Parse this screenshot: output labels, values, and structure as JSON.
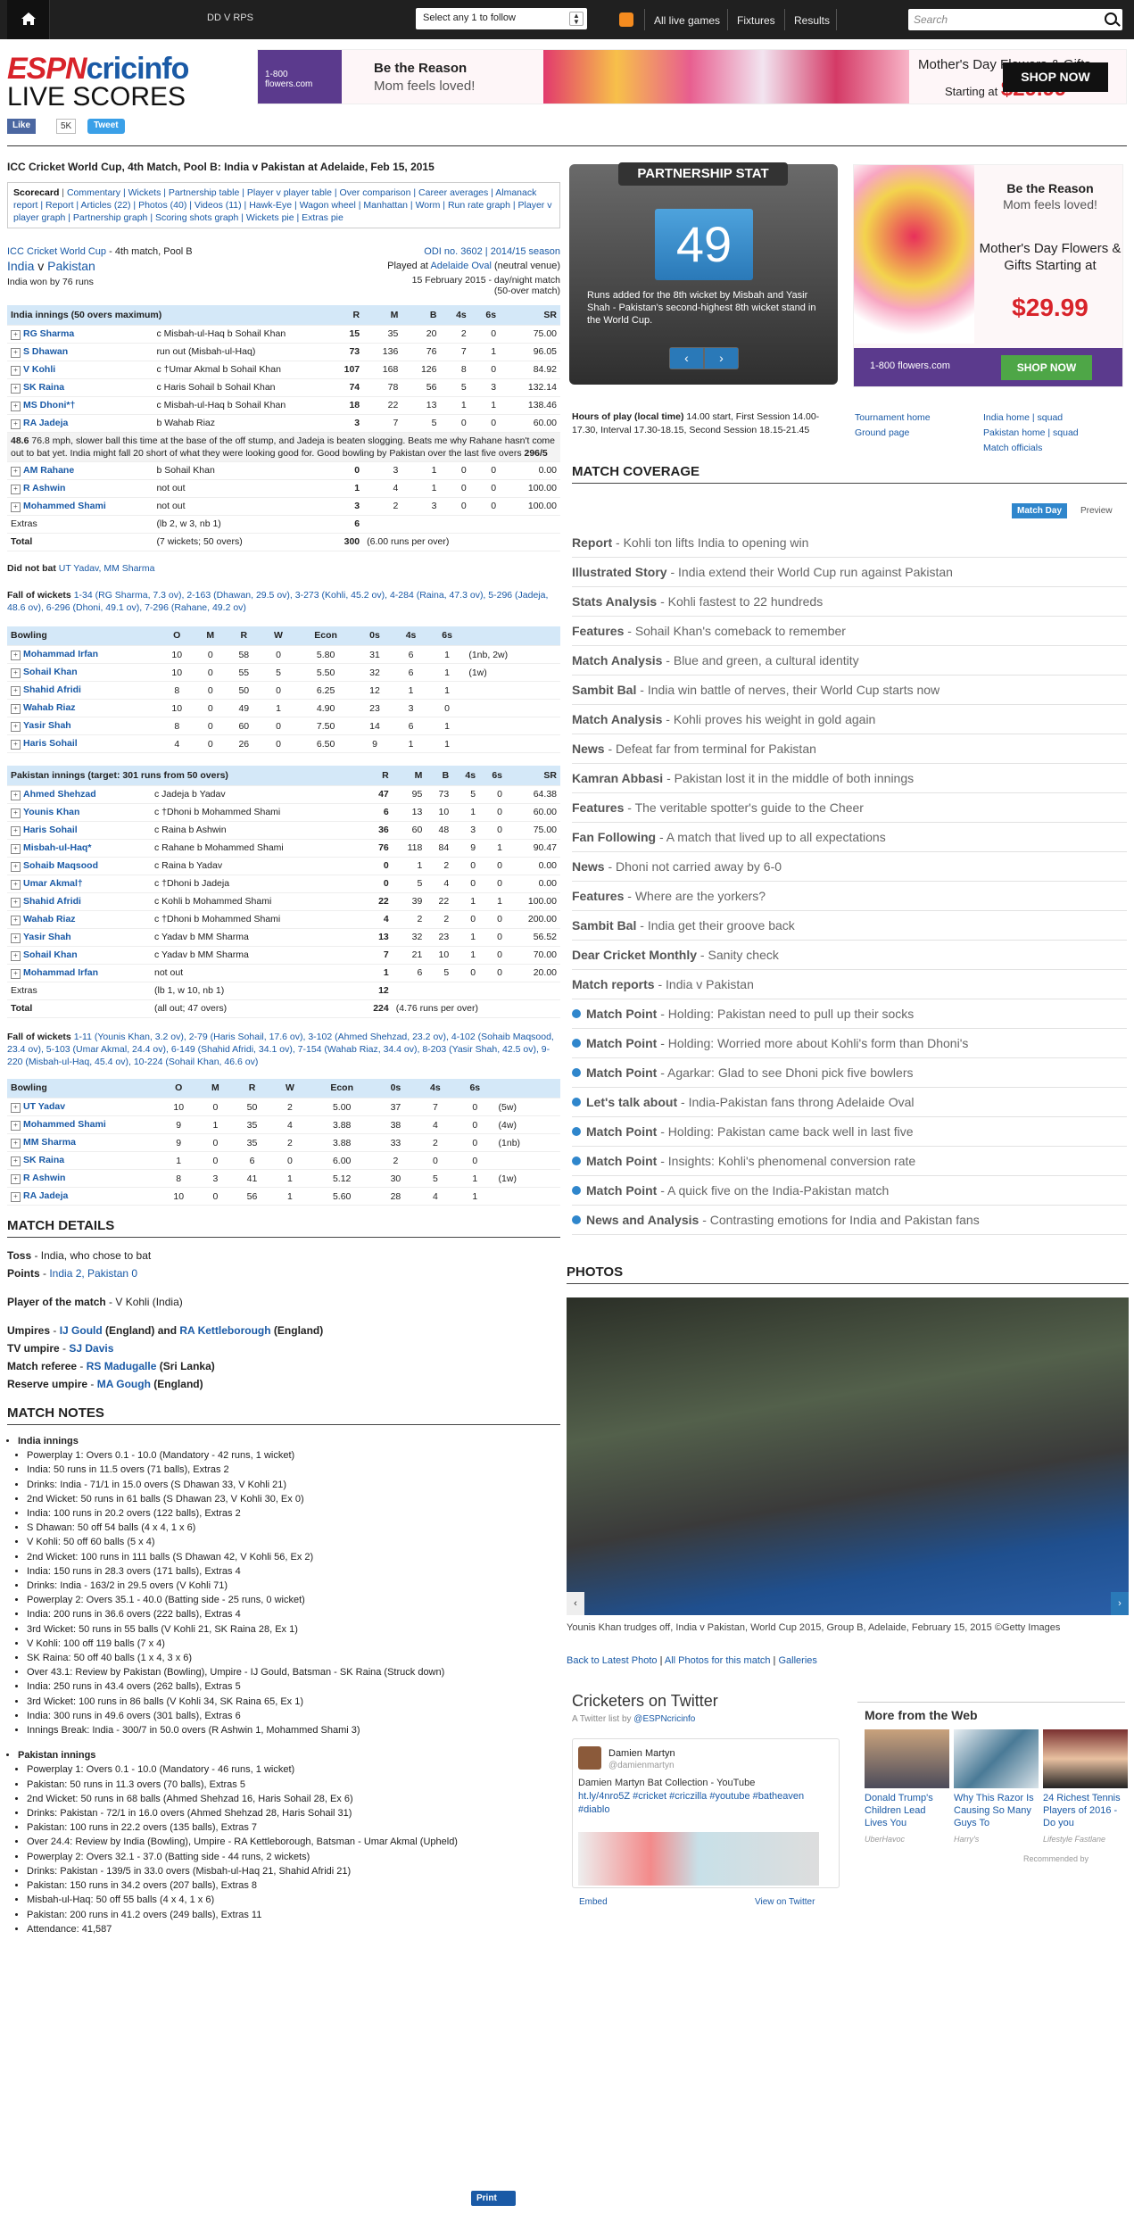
{
  "topbar": {
    "ddvrps": "DD V RPS",
    "follow": "Select any 1 to follow",
    "nav": [
      "All live games",
      "Fixtures",
      "Results"
    ],
    "search_placeholder": "Search"
  },
  "header": {
    "logo_espn": "ESPN",
    "logo_cric": "cricinfo",
    "live": "LIVE SCORES",
    "fb_like": "Like",
    "fb_count": "5K",
    "tweet": "Tweet"
  },
  "topad": {
    "brand": "1-800 flowers.com",
    "t1": "Be the Reason",
    "t2": "Mom feels loved!",
    "t3": "Mother's Day Flowers & Gifts",
    "t4_prefix": "Starting at ",
    "price": "$29.99",
    "shop": "SHOP NOW"
  },
  "match": {
    "title": "ICC Cricket World Cup, 4th Match, Pool B: India v Pakistan at Adelaide, Feb 15, 2015",
    "links_label": "Scorecard",
    "links": "Commentary | Wickets | Partnership table | Player v player table | Over comparison | Career averages | Almanack report | Report | Articles (22) | Photos (40) | Videos (11) | Hawk-Eye | Wagon wheel | Manhattan | Worm | Run rate graph | Player v player graph | Partnership graph | Scoring shots graph | Wickets pie | Extras pie",
    "series": "ICC Cricket World Cup",
    "matchno": " - 4th match, Pool B",
    "odi": "ODI no. 3602 | 2014/15 season",
    "t1": "India",
    "v": " v ",
    "t2": "Pakistan",
    "played_at": "Played at ",
    "venue": "Adelaide Oval",
    "neutral": " (neutral venue)",
    "result": "India won by 76 runs",
    "date": "15 February 2015 - day/night match",
    "overs": "(50-over match)"
  },
  "india_bat": {
    "hd": [
      "India innings (50 overs maximum)",
      "R",
      "M",
      "B",
      "4s",
      "6s",
      "SR"
    ],
    "rows": [
      [
        "RG Sharma",
        "c Misbah-ul-Haq b Sohail Khan",
        "15",
        "35",
        "20",
        "2",
        "0",
        "75.00"
      ],
      [
        "S Dhawan",
        "run out (Misbah-ul-Haq)",
        "73",
        "136",
        "76",
        "7",
        "1",
        "96.05"
      ],
      [
        "V Kohli",
        "c †Umar Akmal b Sohail Khan",
        "107",
        "168",
        "126",
        "8",
        "0",
        "84.92"
      ],
      [
        "SK Raina",
        "c Haris Sohail b Sohail Khan",
        "74",
        "78",
        "56",
        "5",
        "3",
        "132.14"
      ],
      [
        "MS Dhoni*†",
        "c Misbah-ul-Haq b Sohail Khan",
        "18",
        "22",
        "13",
        "1",
        "1",
        "138.46"
      ],
      [
        "RA Jadeja",
        "b Wahab Riaz",
        "3",
        "7",
        "5",
        "0",
        "0",
        "60.00"
      ]
    ],
    "comm_ov": "48.6",
    "comm": "76.8 mph, slower ball this time at the base of the off stump, and Jadeja is beaten slogging. Beats me why Rahane hasn't come out to bat yet. India might fall 20 short of what they were looking good for. Good bowling by Pakistan over the last five overs ",
    "comm_score": "296/5",
    "rows2": [
      [
        "AM Rahane",
        "b Sohail Khan",
        "0",
        "3",
        "1",
        "0",
        "0",
        "0.00"
      ],
      [
        "R Ashwin",
        "not out",
        "1",
        "4",
        "1",
        "0",
        "0",
        "100.00"
      ],
      [
        "Mohammed Shami",
        "not out",
        "3",
        "2",
        "3",
        "0",
        "0",
        "100.00"
      ]
    ],
    "extras": [
      "Extras",
      "(lb 2, w 3, nb 1)",
      "6"
    ],
    "total": [
      "Total",
      "(7 wickets; 50 overs)",
      "300",
      "(6.00 runs per over)"
    ],
    "dnb_label": "Did not bat ",
    "dnb": "UT Yadav, MM Sharma",
    "fow_label": "Fall of wickets ",
    "fow": "1-34 (RG Sharma, 7.3 ov), 2-163 (Dhawan, 29.5 ov), 3-273 (Kohli, 45.2 ov), 4-284 (Raina, 47.3 ov), 5-296 (Jadeja, 48.6 ov), 6-296 (Dhoni, 49.1 ov), 7-296 (Rahane, 49.2 ov)"
  },
  "pak_bowl": {
    "hd": [
      "Bowling",
      "O",
      "M",
      "R",
      "W",
      "Econ",
      "0s",
      "4s",
      "6s",
      ""
    ],
    "rows": [
      [
        "Mohammad Irfan",
        "10",
        "0",
        "58",
        "0",
        "5.80",
        "31",
        "6",
        "1",
        "(1nb, 2w)"
      ],
      [
        "Sohail Khan",
        "10",
        "0",
        "55",
        "5",
        "5.50",
        "32",
        "6",
        "1",
        "(1w)"
      ],
      [
        "Shahid Afridi",
        "8",
        "0",
        "50",
        "0",
        "6.25",
        "12",
        "1",
        "1",
        ""
      ],
      [
        "Wahab Riaz",
        "10",
        "0",
        "49",
        "1",
        "4.90",
        "23",
        "3",
        "0",
        ""
      ],
      [
        "Yasir Shah",
        "8",
        "0",
        "60",
        "0",
        "7.50",
        "14",
        "6",
        "1",
        ""
      ],
      [
        "Haris Sohail",
        "4",
        "0",
        "26",
        "0",
        "6.50",
        "9",
        "1",
        "1",
        ""
      ]
    ]
  },
  "pak_bat": {
    "hd": [
      "Pakistan innings (target: 301 runs from 50 overs)",
      "R",
      "M",
      "B",
      "4s",
      "6s",
      "SR"
    ],
    "rows": [
      [
        "Ahmed Shehzad",
        "c Jadeja b Yadav",
        "47",
        "95",
        "73",
        "5",
        "0",
        "64.38"
      ],
      [
        "Younis Khan",
        "c †Dhoni b Mohammed Shami",
        "6",
        "13",
        "10",
        "1",
        "0",
        "60.00"
      ],
      [
        "Haris Sohail",
        "c Raina b Ashwin",
        "36",
        "60",
        "48",
        "3",
        "0",
        "75.00"
      ],
      [
        "Misbah-ul-Haq*",
        "c Rahane b Mohammed Shami",
        "76",
        "118",
        "84",
        "9",
        "1",
        "90.47"
      ],
      [
        "Sohaib Maqsood",
        "c Raina b Yadav",
        "0",
        "1",
        "2",
        "0",
        "0",
        "0.00"
      ],
      [
        "Umar Akmal†",
        "c †Dhoni b Jadeja",
        "0",
        "5",
        "4",
        "0",
        "0",
        "0.00"
      ],
      [
        "Shahid Afridi",
        "c Kohli b Mohammed Shami",
        "22",
        "39",
        "22",
        "1",
        "1",
        "100.00"
      ],
      [
        "Wahab Riaz",
        "c †Dhoni b Mohammed Shami",
        "4",
        "2",
        "2",
        "0",
        "0",
        "200.00"
      ],
      [
        "Yasir Shah",
        "c Yadav b MM Sharma",
        "13",
        "32",
        "23",
        "1",
        "0",
        "56.52"
      ],
      [
        "Sohail Khan",
        "c Yadav b MM Sharma",
        "7",
        "21",
        "10",
        "1",
        "0",
        "70.00"
      ],
      [
        "Mohammad Irfan",
        "not out",
        "1",
        "6",
        "5",
        "0",
        "0",
        "20.00"
      ]
    ],
    "extras": [
      "Extras",
      "(lb 1, w 10, nb 1)",
      "12"
    ],
    "total": [
      "Total",
      "(all out; 47 overs)",
      "224",
      "(4.76 runs per over)"
    ],
    "fow_label": "Fall of wickets ",
    "fow": "1-11 (Younis Khan, 3.2 ov), 2-79 (Haris Sohail, 17.6 ov), 3-102 (Ahmed Shehzad, 23.2 ov), 4-102 (Sohaib Maqsood, 23.4 ov), 5-103 (Umar Akmal, 24.4 ov), 6-149 (Shahid Afridi, 34.1 ov), 7-154 (Wahab Riaz, 34.4 ov), 8-203 (Yasir Shah, 42.5 ov), 9-220 (Misbah-ul-Haq, 45.4 ov), 10-224 (Sohail Khan, 46.6 ov)"
  },
  "ind_bowl": {
    "hd": [
      "Bowling",
      "O",
      "M",
      "R",
      "W",
      "Econ",
      "0s",
      "4s",
      "6s",
      ""
    ],
    "rows": [
      [
        "UT Yadav",
        "10",
        "0",
        "50",
        "2",
        "5.00",
        "37",
        "7",
        "0",
        "(5w)"
      ],
      [
        "Mohammed Shami",
        "9",
        "1",
        "35",
        "4",
        "3.88",
        "38",
        "4",
        "0",
        "(4w)"
      ],
      [
        "MM Sharma",
        "9",
        "0",
        "35",
        "2",
        "3.88",
        "33",
        "2",
        "0",
        "(1nb)"
      ],
      [
        "SK Raina",
        "1",
        "0",
        "6",
        "0",
        "6.00",
        "2",
        "0",
        "0",
        ""
      ],
      [
        "R Ashwin",
        "8",
        "3",
        "41",
        "1",
        "5.12",
        "30",
        "5",
        "1",
        "(1w)"
      ],
      [
        "RA Jadeja",
        "10",
        "0",
        "56",
        "1",
        "5.60",
        "28",
        "4",
        "1",
        ""
      ]
    ]
  },
  "details": {
    "h": "MATCH DETAILS",
    "toss_l": "Toss",
    "toss": " - India, who chose to bat",
    "pts_l": "Points",
    "pts": "India 2, Pakistan 0",
    "pom_l": "Player of the match",
    "pom": " - V Kohli (India)",
    "ump_l": "Umpires",
    "ump1": "IJ Gould",
    "ump1c": " (England) and ",
    "ump2": "RA Kettleborough",
    "ump2c": " (England)",
    "tv_l": "TV umpire",
    "tv": "SJ Davis",
    "ref_l": "Match referee",
    "ref": "RS Madugalle",
    "refc": " (Sri Lanka)",
    "res_l": "Reserve umpire",
    "res": "MA Gough",
    "resc": " (England)"
  },
  "notes": {
    "h": "MATCH NOTES",
    "ind_h": "India innings",
    "ind": [
      "Powerplay 1: Overs 0.1 - 10.0 (Mandatory - 42 runs, 1 wicket)",
      "India: 50 runs in 11.5 overs (71 balls), Extras 2",
      "Drinks: India - 71/1 in 15.0 overs (S Dhawan 33, V Kohli 21)",
      "2nd Wicket: 50 runs in 61 balls (S Dhawan 23, V Kohli 30, Ex 0)",
      "India: 100 runs in 20.2 overs (122 balls), Extras 2",
      "S Dhawan: 50 off 54 balls (4 x 4, 1 x 6)",
      "V Kohli: 50 off 60 balls (5 x 4)",
      "2nd Wicket: 100 runs in 111 balls (S Dhawan 42, V Kohli 56, Ex 2)",
      "India: 150 runs in 28.3 overs (171 balls), Extras 4",
      "Drinks: India - 163/2 in 29.5 overs (V Kohli 71)",
      "Powerplay 2: Overs 35.1 - 40.0 (Batting side - 25 runs, 0 wicket)",
      "India: 200 runs in 36.6 overs (222 balls), Extras 4",
      "3rd Wicket: 50 runs in 55 balls (V Kohli 21, SK Raina 28, Ex 1)",
      "V Kohli: 100 off 119 balls (7 x 4)",
      "SK Raina: 50 off 40 balls (1 x 4, 3 x 6)",
      "Over 43.1: Review by Pakistan (Bowling), Umpire - IJ Gould, Batsman - SK Raina (Struck down)",
      "India: 250 runs in 43.4 overs (262 balls), Extras 5",
      "3rd Wicket: 100 runs in 86 balls (V Kohli 34, SK Raina 65, Ex 1)",
      "India: 300 runs in 49.6 overs (301 balls), Extras 6",
      "Innings Break: India - 300/7 in 50.0 overs (R Ashwin 1, Mohammed Shami 3)"
    ],
    "pak_h": "Pakistan innings",
    "pak": [
      "Powerplay 1: Overs 0.1 - 10.0 (Mandatory - 46 runs, 1 wicket)",
      "Pakistan: 50 runs in 11.3 overs (70 balls), Extras 5",
      "2nd Wicket: 50 runs in 68 balls (Ahmed Shehzad 16, Haris Sohail 28, Ex 6)",
      "Drinks: Pakistan - 72/1 in 16.0 overs (Ahmed Shehzad 28, Haris Sohail 31)",
      "Pakistan: 100 runs in 22.2 overs (135 balls), Extras 7",
      "Over 24.4: Review by India (Bowling), Umpire - RA Kettleborough, Batsman - Umar Akmal (Upheld)",
      "Powerplay 2: Overs 32.1 - 37.0 (Batting side - 44 runs, 2 wickets)",
      "Drinks: Pakistan - 139/5 in 33.0 overs (Misbah-ul-Haq 21, Shahid Afridi 21)",
      "Pakistan: 150 runs in 34.2 overs (207 balls), Extras 8",
      "Misbah-ul-Haq: 50 off 55 balls (4 x 4, 1 x 6)",
      "Pakistan: 200 runs in 41.2 overs (249 balls), Extras 11",
      "Attendance: 41,587"
    ],
    "print": "Print"
  },
  "pship": {
    "cap": "PARTNERSHIP STAT",
    "num": "49",
    "txt": "Runs added for the 8th wicket by Misbah and Yasir Shah - Pakistan's second-highest 8th wicket stand in the World Cup."
  },
  "sidead": {
    "t1": "Be the Reason",
    "t2": "Mom feels loved!",
    "t3": "Mother's Day Flowers & Gifts Starting at",
    "price": "$29.99",
    "brand": "1-800 flowers.com",
    "shop": "SHOP NOW"
  },
  "hours": {
    "l": "Hours of play (local time)",
    "t": " 14.00 start, First Session 14.00-17.30, Interval 17.30-18.15, Second Session 18.15-21.45",
    "a": [
      "Tournament home",
      "Ground page"
    ],
    "b": [
      "India home | squad",
      "Pakistan home | squad",
      "Match officials"
    ]
  },
  "coverage": {
    "h": "MATCH COVERAGE",
    "tab": "Match Day",
    "preview": "Preview",
    "items": [
      [
        "Report",
        "Kohli ton lifts India to opening win",
        0
      ],
      [
        "Illustrated Story",
        "India extend their World Cup run against Pakistan",
        0
      ],
      [
        "Stats Analysis",
        "Kohli fastest to 22 hundreds",
        0
      ],
      [
        "Features",
        "Sohail Khan's comeback to remember",
        0
      ],
      [
        "Match Analysis",
        "Blue and green, a cultural identity",
        0
      ],
      [
        "Sambit Bal",
        "India win battle of nerves, their World Cup starts now",
        0
      ],
      [
        "Match Analysis",
        "Kohli proves his weight in gold again",
        0
      ],
      [
        "News",
        "Defeat far from terminal for Pakistan",
        0
      ],
      [
        "Kamran Abbasi",
        "Pakistan lost it in the middle of both innings",
        0
      ],
      [
        "Features",
        "The veritable spotter's guide to the Cheer",
        0
      ],
      [
        "Fan Following",
        "A match that lived up to all expectations",
        0
      ],
      [
        "News",
        "Dhoni not carried away by 6-0",
        0
      ],
      [
        "Features",
        "Where are the yorkers?",
        0
      ],
      [
        "Sambit Bal",
        "India get their groove back",
        0
      ],
      [
        "Dear Cricket Monthly",
        "Sanity check",
        0
      ],
      [
        "Match reports",
        "India v Pakistan",
        0
      ],
      [
        "Match Point",
        "Holding: Pakistan need to pull up their socks",
        1
      ],
      [
        "Match Point",
        "Holding: Worried more about Kohli's form than Dhoni's",
        1
      ],
      [
        "Match Point",
        "Agarkar: Glad to see Dhoni pick five bowlers",
        1
      ],
      [
        "Let's talk about",
        "India-Pakistan fans throng Adelaide Oval",
        1
      ],
      [
        "Match Point",
        "Holding: Pakistan came back well in last five",
        1
      ],
      [
        "Match Point",
        "Insights: Kohli's phenomenal conversion rate",
        1
      ],
      [
        "Match Point",
        "A quick five on the India-Pakistan match",
        1
      ],
      [
        "News and Analysis",
        "Contrasting emotions for India and Pakistan fans",
        1
      ]
    ]
  },
  "photos": {
    "h": "PHOTOS",
    "caption": "Younis Khan trudges off, India v Pakistan, World Cup 2015, Group B, Adelaide, February 15, 2015",
    "credit": " ©Getty Images",
    "links": [
      "Back to Latest Photo",
      "All Photos for this match",
      "Galleries"
    ]
  },
  "twitter": {
    "h": "Cricketers on Twitter",
    "sub": "A Twitter list by ",
    "subh": "@ESPNcricinfo",
    "name": "Damien Martyn",
    "handle": "@damienmartyn",
    "text": "Damien Martyn Bat Collection - YouTube",
    "links": "ht.ly/4nro5Z #cricket #criczilla #youtube #batheaven #diablo",
    "embed": "Embed",
    "view": "View on Twitter"
  },
  "web": {
    "h": "More from the Web",
    "items": [
      [
        "Donald Trump's Children Lead Lives You",
        "UberHavoc"
      ],
      [
        "Why This Razor Is Causing So Many Guys To",
        "Harry's"
      ],
      [
        "24 Richest Tennis Players of 2016 - Do you",
        "Lifestyle Fastlane"
      ]
    ],
    "rec": "Recommended by"
  }
}
